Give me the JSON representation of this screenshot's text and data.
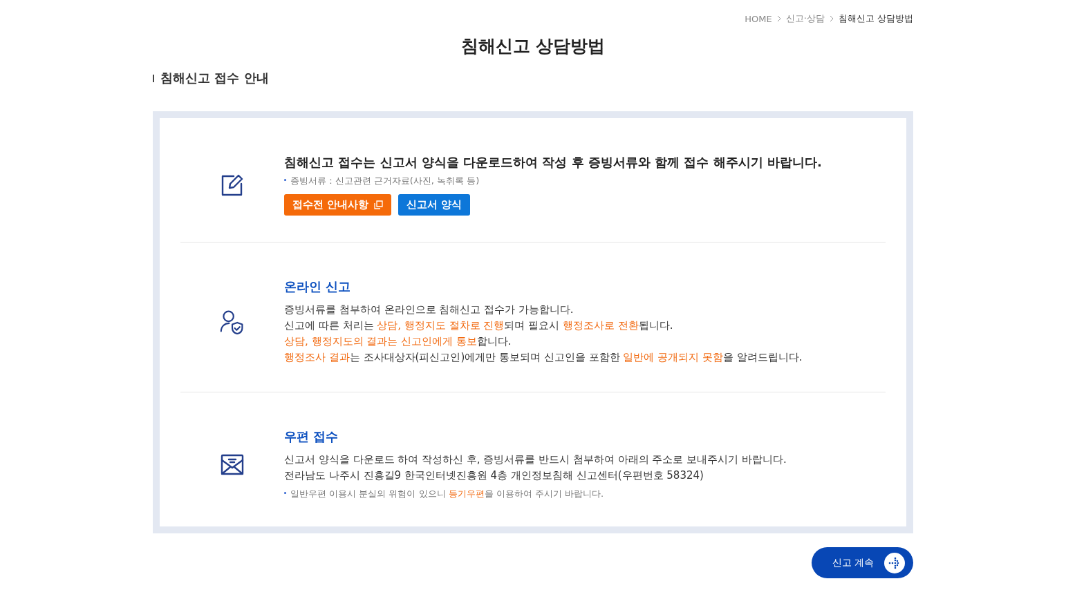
{
  "breadcrumb": [
    {
      "label": "HOME",
      "current": false
    },
    {
      "label": "신고·상담",
      "current": false
    },
    {
      "label": "침해신고 상담방법",
      "current": true
    }
  ],
  "page_title": "침해신고 상담방법",
  "section_title": "침해신고 접수 안내",
  "blocks": [
    {
      "kind": "form",
      "heading": "침해신고 접수는 신고서 양식을 다운로드하여 작성 후 증빙서류와 함께 접수 해주시기 바랍니다.",
      "note": [
        {
          "text": "증빙서류 : 신고관련 근거자료(사진, 녹취록 등)",
          "highlight": false
        }
      ],
      "buttons": [
        {
          "label": "접수전 안내사항",
          "kind": "popup"
        },
        {
          "label": "신고서 양식",
          "kind": "download"
        }
      ]
    },
    {
      "kind": "online",
      "heading": "온라인 신고",
      "lines": [
        [
          {
            "text": "증빙서류를 첨부하여 온라인으로 침해신고 접수가 가능합니다.",
            "highlight": false
          }
        ],
        [
          {
            "text": "신고에 따른 처리는 ",
            "highlight": false
          },
          {
            "text": "상담, 행정지도 절차로 진행",
            "highlight": true
          },
          {
            "text": "되며 필요시 ",
            "highlight": false
          },
          {
            "text": "행정조사로 전환",
            "highlight": true
          },
          {
            "text": "됩니다.",
            "highlight": false
          }
        ],
        [
          {
            "text": "상담, 행정지도의 결과는 신고인에게 통보",
            "highlight": true
          },
          {
            "text": "합니다.",
            "highlight": false
          }
        ],
        [
          {
            "text": "행정조사 결과",
            "highlight": true
          },
          {
            "text": "는 조사대상자(피신고인)에게만 통보되며 신고인을 포함한 ",
            "highlight": false
          },
          {
            "text": "일반에 공개되지 못함",
            "highlight": true
          },
          {
            "text": "을 알려드립니다.",
            "highlight": false
          }
        ]
      ]
    },
    {
      "kind": "mail",
      "heading": "우편 접수",
      "lines": [
        [
          {
            "text": "신고서 양식을 다운로드 하여 작성하신 후, 증빙서류를 반드시 첨부하여 아래의 주소로 보내주시기 바랍니다.",
            "highlight": false
          }
        ],
        [
          {
            "text": "전라남도 나주시 진흥길9 한국인터넷진흥원 4층 개인정보침해 신고센터(우편번호 58324)",
            "highlight": false
          }
        ]
      ],
      "note": [
        {
          "text": "일반우편 이용시 분실의 위험이 있으니 ",
          "highlight": false
        },
        {
          "text": "등기우편",
          "highlight": true
        },
        {
          "text": "을 이용하여 주시기 바랍니다.",
          "highlight": false
        }
      ]
    }
  ],
  "continue_button": {
    "label": "신고 계속"
  }
}
